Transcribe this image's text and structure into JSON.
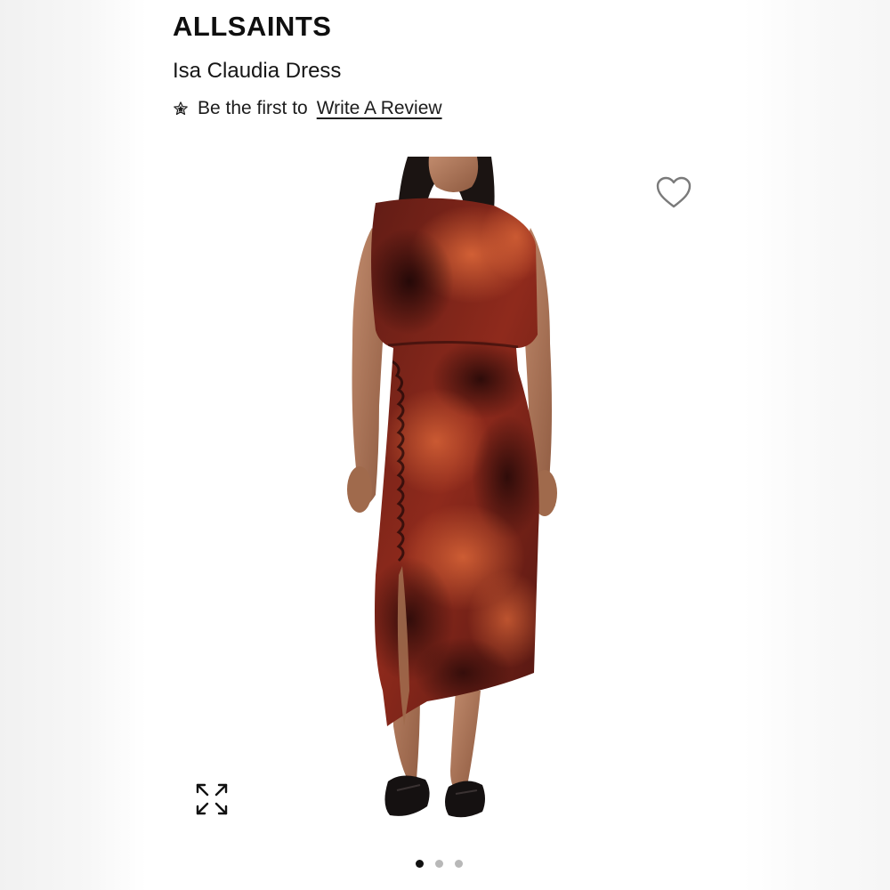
{
  "brand": "ALLSAINTS",
  "product": {
    "name": "Isa Claudia Dress"
  },
  "review": {
    "prompt": "Be the first to",
    "link_label": "Write A Review",
    "icon": "star-icon"
  },
  "gallery": {
    "image_subject": "model-wearing-dress-photo",
    "wishlist_icon": "heart-outline-icon",
    "expand_icon": "expand-arrows-icon",
    "slide_count": 3,
    "active_slide": 1
  },
  "colors": {
    "text": "#111111",
    "dot_inactive": "#b8b8b8",
    "dot_active": "#111111",
    "dress_dark": "#2a0c0a",
    "dress_red": "#9c2a1d",
    "dress_orange": "#d0522b"
  }
}
